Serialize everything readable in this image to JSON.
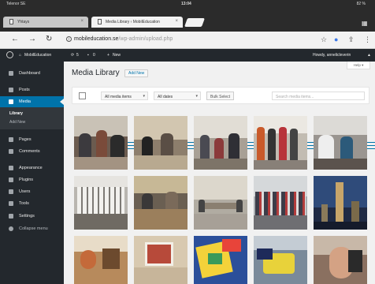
{
  "status": {
    "carrier": "Telenor SE",
    "time": "13:04",
    "battery": "82 %"
  },
  "tabs": [
    {
      "label": "Yhtays"
    },
    {
      "label": "Media Library ‹ MobilEducation"
    }
  ],
  "address": {
    "host": "mobileducation.se",
    "path": "/wp-admin/upload.php"
  },
  "adminbar": {
    "site": "MobilEducation",
    "updates": "5",
    "comments": "0",
    "new": "New",
    "greeting": "Howdy, annelicleverin"
  },
  "sidebar": {
    "items": [
      {
        "label": "Dashboard",
        "icon": "dashboard-icon"
      },
      {
        "label": "Posts",
        "icon": "pin-icon"
      },
      {
        "label": "Media",
        "icon": "media-icon"
      },
      {
        "label": "Pages",
        "icon": "page-icon"
      },
      {
        "label": "Comments",
        "icon": "comment-icon"
      },
      {
        "label": "Appearance",
        "icon": "brush-icon"
      },
      {
        "label": "Plugins",
        "icon": "plug-icon"
      },
      {
        "label": "Users",
        "icon": "user-icon"
      },
      {
        "label": "Tools",
        "icon": "wrench-icon"
      },
      {
        "label": "Settings",
        "icon": "settings-icon"
      },
      {
        "label": "Collapse menu",
        "icon": "collapse-icon"
      }
    ],
    "submenu": [
      "Library",
      "Add New"
    ]
  },
  "main": {
    "title": "Media Library",
    "add_new": "Add New",
    "help": "Help",
    "filters": {
      "type": "All media items",
      "dates": "All dates",
      "bulk": "Bulk Select",
      "search_placeholder": "Search media items..."
    }
  },
  "colors": {
    "wp_dark": "#23282d",
    "wp_blue": "#0073aa",
    "content_bg": "#f1f1f1"
  }
}
